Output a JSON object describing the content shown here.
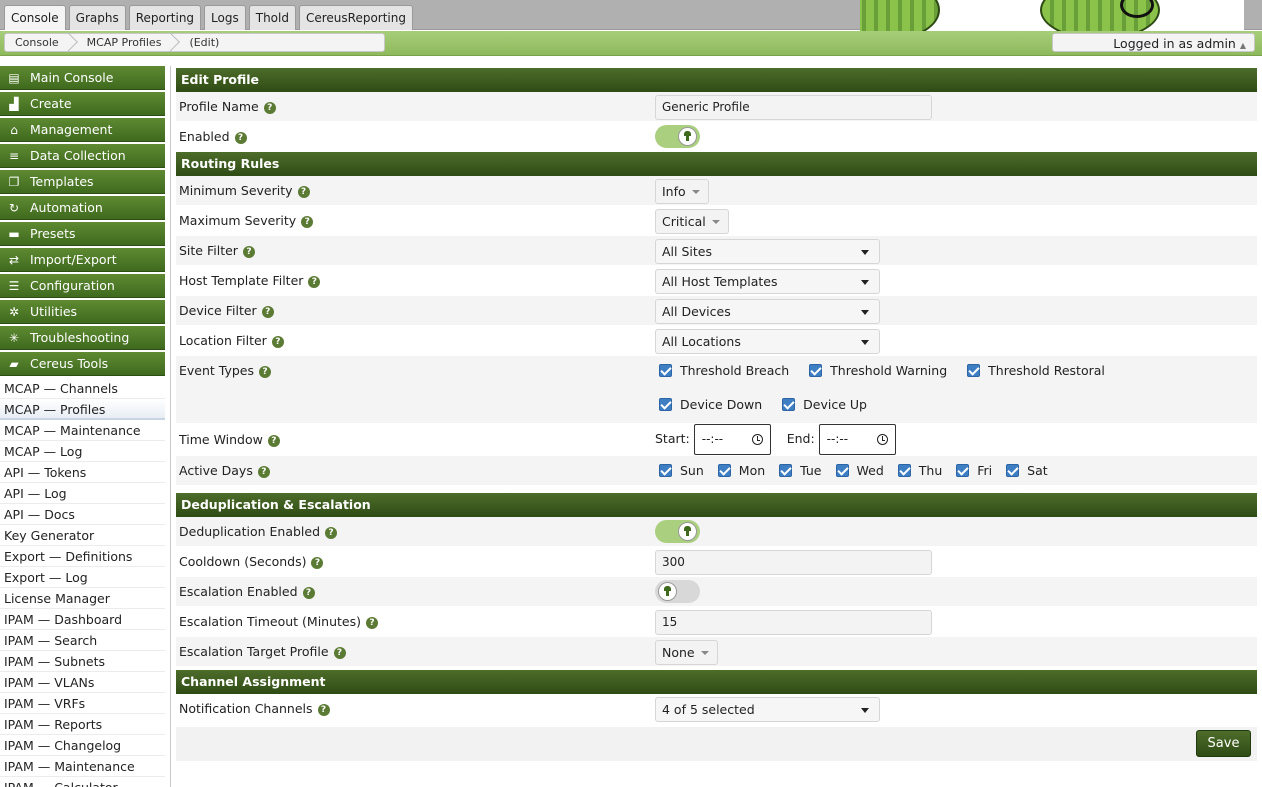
{
  "tabs": [
    "Console",
    "Graphs",
    "Reporting",
    "Logs",
    "Thold",
    "CereusReporting"
  ],
  "breadcrumbs": [
    "Console",
    "MCAP Profiles",
    "(Edit)"
  ],
  "login": {
    "text": "Logged in as admin",
    "arrow": "▲"
  },
  "sidebar": {
    "headers": [
      {
        "label": "Main Console",
        "icon": "map-icon"
      },
      {
        "label": "Create",
        "icon": "chart-icon"
      },
      {
        "label": "Management",
        "icon": "home-icon"
      },
      {
        "label": "Data Collection",
        "icon": "database-icon"
      },
      {
        "label": "Templates",
        "icon": "copy-icon"
      },
      {
        "label": "Automation",
        "icon": "refresh-icon"
      },
      {
        "label": "Presets",
        "icon": "archive-icon"
      },
      {
        "label": "Import/Export",
        "icon": "exchange-icon"
      },
      {
        "label": "Configuration",
        "icon": "sliders-icon"
      },
      {
        "label": "Utilities",
        "icon": "gears-icon"
      },
      {
        "label": "Troubleshooting",
        "icon": "bug-icon"
      },
      {
        "label": "Cereus Tools",
        "icon": "folder-icon"
      }
    ],
    "items": [
      "MCAP — Channels",
      "MCAP — Profiles",
      "MCAP — Maintenance",
      "MCAP — Log",
      "API — Tokens",
      "API — Log",
      "API — Docs",
      "Key Generator",
      "Export — Definitions",
      "Export — Log",
      "License Manager",
      "IPAM — Dashboard",
      "IPAM — Search",
      "IPAM — Subnets",
      "IPAM — VLANs",
      "IPAM — VRFs",
      "IPAM — Reports",
      "IPAM — Changelog",
      "IPAM — Maintenance",
      "IPAM — Calculator"
    ],
    "selected_index": 1
  },
  "sections": {
    "edit": "Edit Profile",
    "routing": "Routing Rules",
    "dedup": "Deduplication & Escalation",
    "channels": "Channel Assignment"
  },
  "form": {
    "profile_name_label": "Profile Name",
    "profile_name_value": "Generic Profile",
    "enabled_label": "Enabled",
    "enabled_on": true,
    "min_sev_label": "Minimum Severity",
    "min_sev_value": "Info",
    "max_sev_label": "Maximum Severity",
    "max_sev_value": "Critical",
    "site_label": "Site Filter",
    "site_value": "All Sites",
    "host_tpl_label": "Host Template Filter",
    "host_tpl_value": "All Host Templates",
    "device_label": "Device Filter",
    "device_value": "All Devices",
    "location_label": "Location Filter",
    "location_value": "All Locations",
    "event_types_label": "Event Types",
    "event_types": [
      "Threshold Breach",
      "Threshold Warning",
      "Threshold Restoral",
      "Device Down",
      "Device Up"
    ],
    "time_window_label": "Time Window",
    "start_label": "Start:",
    "start_value": "--:--",
    "end_label": "End:",
    "end_value": "--:--",
    "active_days_label": "Active Days",
    "days": [
      "Sun",
      "Mon",
      "Tue",
      "Wed",
      "Thu",
      "Fri",
      "Sat"
    ],
    "dedup_label": "Deduplication Enabled",
    "dedup_on": true,
    "cooldown_label": "Cooldown (Seconds)",
    "cooldown_value": "300",
    "escal_label": "Escalation Enabled",
    "escal_on": false,
    "escal_timeout_label": "Escalation Timeout (Minutes)",
    "escal_timeout_value": "15",
    "escal_target_label": "Escalation Target Profile",
    "escal_target_value": "None",
    "notif_label": "Notification Channels",
    "notif_value": "4 of 5 selected",
    "help_glyph": "?"
  },
  "save_label": "Save"
}
